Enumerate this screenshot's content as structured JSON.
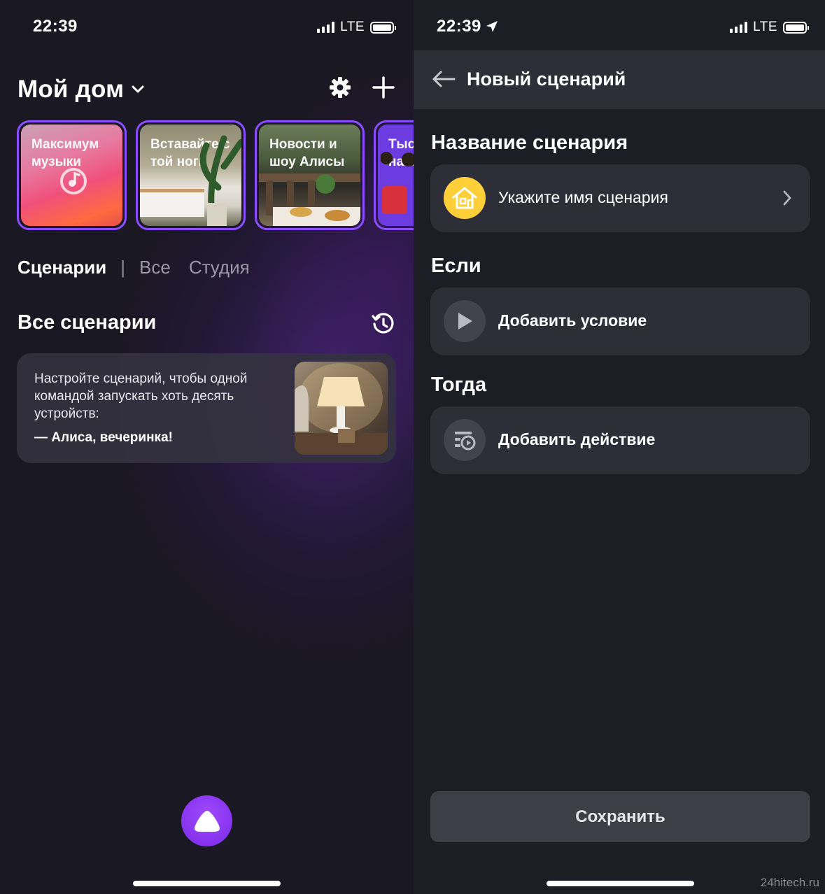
{
  "left": {
    "status": {
      "time": "22:39",
      "network": "LTE"
    },
    "header": {
      "title": "Мой дом"
    },
    "stories": [
      {
        "caption": "Максимум музыки"
      },
      {
        "caption": "Вставайте с той ноги"
      },
      {
        "caption": "Новости и шоу Алисы"
      },
      {
        "caption": "Тысяч навыков"
      }
    ],
    "tabs": {
      "active": "Сценарии",
      "separator": "|",
      "items": [
        "Все",
        "Студия"
      ]
    },
    "section": {
      "title": "Все сценарии"
    },
    "promo_card": {
      "text": "Настройте сценарий, чтобы одной командой запускать хоть десять устройств:",
      "command": "— Алиса, вечеринка!"
    }
  },
  "right": {
    "status": {
      "time": "22:39",
      "network": "LTE"
    },
    "nav": {
      "title": "Новый сценарий"
    },
    "name_section": {
      "label": "Название сценария",
      "placeholder": "Укажите имя сценария"
    },
    "if_section": {
      "label": "Если",
      "action": "Добавить условие"
    },
    "then_section": {
      "label": "Тогда",
      "action": "Добавить действие"
    },
    "save": "Сохранить"
  },
  "watermark": "24hitech.ru",
  "colors": {
    "accent": "#8a4dff",
    "card": "#2e2e39",
    "name_icon": "#ffcf3a"
  }
}
